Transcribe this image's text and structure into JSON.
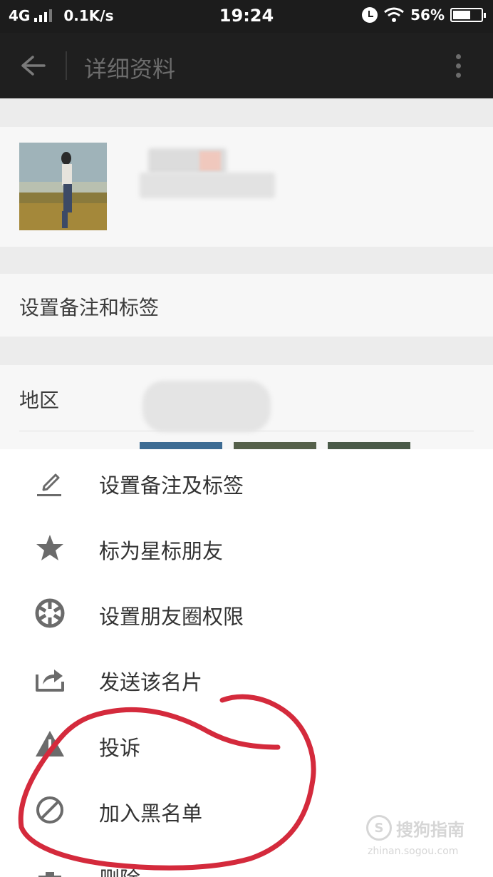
{
  "status_bar": {
    "network": "4G",
    "speed": "0.1K/s",
    "time": "19:24",
    "battery": "56%",
    "battery_level": 0.56
  },
  "header": {
    "title": "详细资料"
  },
  "profile": {
    "remark_row": "设置备注和标签",
    "region_label": "地区"
  },
  "menu": {
    "items": [
      {
        "label": "设置备注及标签",
        "icon": "pencil-icon"
      },
      {
        "label": "标为星标朋友",
        "icon": "star-icon"
      },
      {
        "label": "设置朋友圈权限",
        "icon": "aperture-icon"
      },
      {
        "label": "发送该名片",
        "icon": "share-icon"
      },
      {
        "label": "投诉",
        "icon": "warning-icon"
      },
      {
        "label": "加入黑名单",
        "icon": "block-icon"
      },
      {
        "label": "删除",
        "icon": "trash-icon"
      }
    ]
  },
  "watermark": {
    "text": "搜狗指南",
    "url": "zhinan.sogou.com"
  },
  "colors": {
    "annotation": "#d42a3c",
    "icon": "#6b6b6b"
  }
}
